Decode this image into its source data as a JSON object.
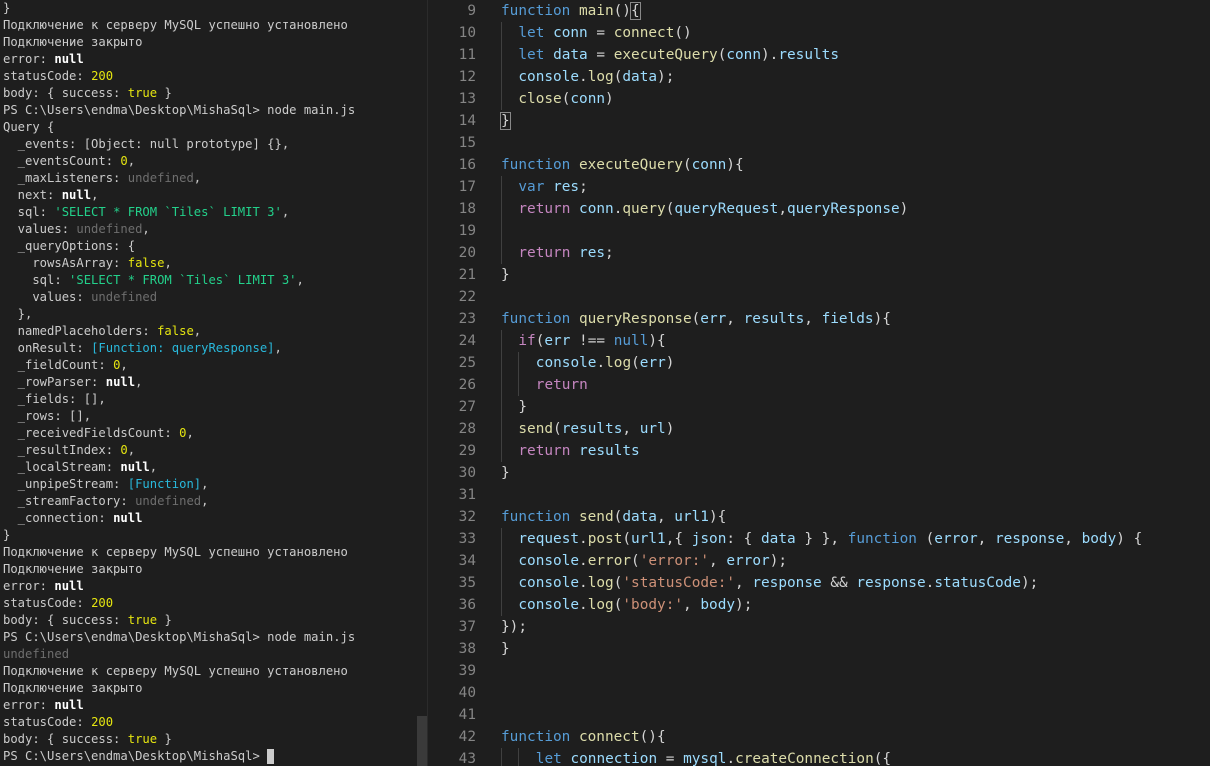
{
  "terminal": {
    "prompt": "PS C:\\Users\\endma\\Desktop\\MishaSql> ",
    "lines": [
      [
        {
          "t": "}",
          "c": ""
        }
      ],
      [
        {
          "t": "Подключение к серверу MySQL успешно установлено",
          "c": ""
        }
      ],
      [
        {
          "t": "Подключение закрыто",
          "c": ""
        }
      ],
      [
        {
          "t": "error: ",
          "c": ""
        },
        {
          "t": "null",
          "c": "t-null"
        }
      ],
      [
        {
          "t": "statusCode: ",
          "c": ""
        },
        {
          "t": "200",
          "c": "t-num"
        }
      ],
      [
        {
          "t": "body: { success: ",
          "c": ""
        },
        {
          "t": "true",
          "c": "t-bool"
        },
        {
          "t": " }",
          "c": ""
        }
      ],
      [
        {
          "t": "PS C:\\Users\\endma\\Desktop\\MishaSql> ",
          "c": ""
        },
        {
          "t": "node main.js",
          "c": ""
        }
      ],
      [
        {
          "t": "Query {",
          "c": ""
        }
      ],
      [
        {
          "t": "  _events: [Object: null prototype] {},",
          "c": ""
        }
      ],
      [
        {
          "t": "  _eventsCount: ",
          "c": ""
        },
        {
          "t": "0",
          "c": "t-num"
        },
        {
          "t": ",",
          "c": ""
        }
      ],
      [
        {
          "t": "  _maxListeners: ",
          "c": ""
        },
        {
          "t": "undefined",
          "c": "t-und"
        },
        {
          "t": ",",
          "c": ""
        }
      ],
      [
        {
          "t": "  next: ",
          "c": ""
        },
        {
          "t": "null",
          "c": "t-null"
        },
        {
          "t": ",",
          "c": ""
        }
      ],
      [
        {
          "t": "  sql: ",
          "c": ""
        },
        {
          "t": "'SELECT * FROM `Tiles` LIMIT 3'",
          "c": "t-str"
        },
        {
          "t": ",",
          "c": ""
        }
      ],
      [
        {
          "t": "  values: ",
          "c": ""
        },
        {
          "t": "undefined",
          "c": "t-und"
        },
        {
          "t": ",",
          "c": ""
        }
      ],
      [
        {
          "t": "  _queryOptions: {",
          "c": ""
        }
      ],
      [
        {
          "t": "    rowsAsArray: ",
          "c": ""
        },
        {
          "t": "false",
          "c": "t-bool"
        },
        {
          "t": ",",
          "c": ""
        }
      ],
      [
        {
          "t": "    sql: ",
          "c": ""
        },
        {
          "t": "'SELECT * FROM `Tiles` LIMIT 3'",
          "c": "t-str"
        },
        {
          "t": ",",
          "c": ""
        }
      ],
      [
        {
          "t": "    values: ",
          "c": ""
        },
        {
          "t": "undefined",
          "c": "t-und"
        }
      ],
      [
        {
          "t": "  },",
          "c": ""
        }
      ],
      [
        {
          "t": "  namedPlaceholders: ",
          "c": ""
        },
        {
          "t": "false",
          "c": "t-bool"
        },
        {
          "t": ",",
          "c": ""
        }
      ],
      [
        {
          "t": "  onResult: ",
          "c": ""
        },
        {
          "t": "[Function: queryResponse]",
          "c": "t-fn"
        },
        {
          "t": ",",
          "c": ""
        }
      ],
      [
        {
          "t": "  _fieldCount: ",
          "c": ""
        },
        {
          "t": "0",
          "c": "t-num"
        },
        {
          "t": ",",
          "c": ""
        }
      ],
      [
        {
          "t": "  _rowParser: ",
          "c": ""
        },
        {
          "t": "null",
          "c": "t-null"
        },
        {
          "t": ",",
          "c": ""
        }
      ],
      [
        {
          "t": "  _fields: [],",
          "c": ""
        }
      ],
      [
        {
          "t": "  _rows: [],",
          "c": ""
        }
      ],
      [
        {
          "t": "  _receivedFieldsCount: ",
          "c": ""
        },
        {
          "t": "0",
          "c": "t-num"
        },
        {
          "t": ",",
          "c": ""
        }
      ],
      [
        {
          "t": "  _resultIndex: ",
          "c": ""
        },
        {
          "t": "0",
          "c": "t-num"
        },
        {
          "t": ",",
          "c": ""
        }
      ],
      [
        {
          "t": "  _localStream: ",
          "c": ""
        },
        {
          "t": "null",
          "c": "t-null"
        },
        {
          "t": ",",
          "c": ""
        }
      ],
      [
        {
          "t": "  _unpipeStream: ",
          "c": ""
        },
        {
          "t": "[Function]",
          "c": "t-fn"
        },
        {
          "t": ",",
          "c": ""
        }
      ],
      [
        {
          "t": "  _streamFactory: ",
          "c": ""
        },
        {
          "t": "undefined",
          "c": "t-und"
        },
        {
          "t": ",",
          "c": ""
        }
      ],
      [
        {
          "t": "  _connection: ",
          "c": ""
        },
        {
          "t": "null",
          "c": "t-null"
        }
      ],
      [
        {
          "t": "}",
          "c": ""
        }
      ],
      [
        {
          "t": "Подключение к серверу MySQL успешно установлено",
          "c": ""
        }
      ],
      [
        {
          "t": "Подключение закрыто",
          "c": ""
        }
      ],
      [
        {
          "t": "error: ",
          "c": ""
        },
        {
          "t": "null",
          "c": "t-null"
        }
      ],
      [
        {
          "t": "statusCode: ",
          "c": ""
        },
        {
          "t": "200",
          "c": "t-num"
        }
      ],
      [
        {
          "t": "body: { success: ",
          "c": ""
        },
        {
          "t": "true",
          "c": "t-bool"
        },
        {
          "t": " }",
          "c": ""
        }
      ],
      [
        {
          "t": "PS C:\\Users\\endma\\Desktop\\MishaSql> ",
          "c": ""
        },
        {
          "t": "node main.js",
          "c": ""
        }
      ],
      [
        {
          "t": "undefined",
          "c": "t-und"
        }
      ],
      [
        {
          "t": "Подключение к серверу MySQL успешно установлено",
          "c": ""
        }
      ],
      [
        {
          "t": "Подключение закрыто",
          "c": ""
        }
      ],
      [
        {
          "t": "error: ",
          "c": ""
        },
        {
          "t": "null",
          "c": "t-null"
        }
      ],
      [
        {
          "t": "statusCode: ",
          "c": ""
        },
        {
          "t": "200",
          "c": "t-num"
        }
      ],
      [
        {
          "t": "body: { success: ",
          "c": ""
        },
        {
          "t": "true",
          "c": "t-bool"
        },
        {
          "t": " }",
          "c": ""
        }
      ]
    ]
  },
  "editor": {
    "lines": [
      {
        "n": "9",
        "g": 0,
        "tokens": [
          [
            "function",
            "kw"
          ],
          [
            " ",
            "pn"
          ],
          [
            "main",
            "fn"
          ],
          [
            "()",
            "pn"
          ],
          [
            "{",
            "pn box"
          ]
        ]
      },
      {
        "n": "10",
        "g": 1,
        "tokens": [
          [
            "let",
            "kw"
          ],
          [
            " ",
            "pn"
          ],
          [
            "conn",
            "var"
          ],
          [
            " = ",
            "pn"
          ],
          [
            "connect",
            "fn"
          ],
          [
            "()",
            "pn"
          ]
        ]
      },
      {
        "n": "11",
        "g": 1,
        "tokens": [
          [
            "let",
            "kw"
          ],
          [
            " ",
            "pn"
          ],
          [
            "data",
            "var"
          ],
          [
            " = ",
            "pn"
          ],
          [
            "executeQuery",
            "fn"
          ],
          [
            "(",
            "pn"
          ],
          [
            "conn",
            "var"
          ],
          [
            ").",
            "pn"
          ],
          [
            "results",
            "var"
          ]
        ]
      },
      {
        "n": "12",
        "g": 1,
        "tokens": [
          [
            "console",
            "var"
          ],
          [
            ".",
            "pn"
          ],
          [
            "log",
            "fn"
          ],
          [
            "(",
            "pn"
          ],
          [
            "data",
            "var"
          ],
          [
            ");",
            "pn"
          ]
        ]
      },
      {
        "n": "13",
        "g": 1,
        "tokens": [
          [
            "close",
            "fn"
          ],
          [
            "(",
            "pn"
          ],
          [
            "conn",
            "var"
          ],
          [
            ")",
            "pn"
          ]
        ]
      },
      {
        "n": "14",
        "g": 0,
        "tokens": [
          [
            "}",
            "pn box"
          ]
        ]
      },
      {
        "n": "15",
        "g": 0,
        "tokens": []
      },
      {
        "n": "16",
        "g": 0,
        "tokens": [
          [
            "function",
            "kw"
          ],
          [
            " ",
            "pn"
          ],
          [
            "executeQuery",
            "fn"
          ],
          [
            "(",
            "pn"
          ],
          [
            "conn",
            "var"
          ],
          [
            "){",
            "pn"
          ]
        ]
      },
      {
        "n": "17",
        "g": 1,
        "tokens": [
          [
            "var",
            "kw"
          ],
          [
            " ",
            "pn"
          ],
          [
            "res",
            "var"
          ],
          [
            ";",
            "pn"
          ]
        ]
      },
      {
        "n": "18",
        "g": 1,
        "tokens": [
          [
            "return",
            "ctl"
          ],
          [
            " ",
            "pn"
          ],
          [
            "conn",
            "var"
          ],
          [
            ".",
            "pn"
          ],
          [
            "query",
            "fn"
          ],
          [
            "(",
            "pn"
          ],
          [
            "queryRequest",
            "var"
          ],
          [
            ",",
            "pn"
          ],
          [
            "queryResponse",
            "var"
          ],
          [
            ")",
            "pn"
          ]
        ]
      },
      {
        "n": "19",
        "g": 1,
        "tokens": []
      },
      {
        "n": "20",
        "g": 1,
        "tokens": [
          [
            "return",
            "ctl"
          ],
          [
            " ",
            "pn"
          ],
          [
            "res",
            "var"
          ],
          [
            ";",
            "pn"
          ]
        ]
      },
      {
        "n": "21",
        "g": 0,
        "tokens": [
          [
            "}",
            "pn"
          ]
        ]
      },
      {
        "n": "22",
        "g": 0,
        "tokens": []
      },
      {
        "n": "23",
        "g": 0,
        "tokens": [
          [
            "function",
            "kw"
          ],
          [
            " ",
            "pn"
          ],
          [
            "queryResponse",
            "fn"
          ],
          [
            "(",
            "pn"
          ],
          [
            "err",
            "var"
          ],
          [
            ", ",
            "pn"
          ],
          [
            "results",
            "var"
          ],
          [
            ", ",
            "pn"
          ],
          [
            "fields",
            "var"
          ],
          [
            "){",
            "pn"
          ]
        ]
      },
      {
        "n": "24",
        "g": 1,
        "tokens": [
          [
            "if",
            "ctl"
          ],
          [
            "(",
            "pn"
          ],
          [
            "err",
            "var"
          ],
          [
            " !== ",
            "pn"
          ],
          [
            "null",
            "kw"
          ],
          [
            "){",
            "pn"
          ]
        ]
      },
      {
        "n": "25",
        "g": 2,
        "tokens": [
          [
            "console",
            "var"
          ],
          [
            ".",
            "pn"
          ],
          [
            "log",
            "fn"
          ],
          [
            "(",
            "pn"
          ],
          [
            "err",
            "var"
          ],
          [
            ")",
            "pn"
          ]
        ]
      },
      {
        "n": "26",
        "g": 2,
        "tokens": [
          [
            "return",
            "ctl"
          ]
        ]
      },
      {
        "n": "27",
        "g": 1,
        "tokens": [
          [
            "}",
            "pn"
          ]
        ]
      },
      {
        "n": "28",
        "g": 1,
        "tokens": [
          [
            "send",
            "fn"
          ],
          [
            "(",
            "pn"
          ],
          [
            "results",
            "var"
          ],
          [
            ", ",
            "pn"
          ],
          [
            "url",
            "var"
          ],
          [
            ")",
            "pn"
          ]
        ]
      },
      {
        "n": "29",
        "g": 1,
        "tokens": [
          [
            "return",
            "ctl"
          ],
          [
            " ",
            "pn"
          ],
          [
            "results",
            "var"
          ]
        ]
      },
      {
        "n": "30",
        "g": 0,
        "tokens": [
          [
            "}",
            "pn"
          ]
        ]
      },
      {
        "n": "31",
        "g": 0,
        "tokens": []
      },
      {
        "n": "32",
        "g": 0,
        "tokens": [
          [
            "function",
            "kw"
          ],
          [
            " ",
            "pn"
          ],
          [
            "send",
            "fn"
          ],
          [
            "(",
            "pn"
          ],
          [
            "data",
            "var"
          ],
          [
            ", ",
            "pn"
          ],
          [
            "url1",
            "var"
          ],
          [
            "){",
            "pn"
          ]
        ]
      },
      {
        "n": "33",
        "g": 1,
        "tokens": [
          [
            "request",
            "var"
          ],
          [
            ".",
            "pn"
          ],
          [
            "post",
            "fn"
          ],
          [
            "(",
            "pn"
          ],
          [
            "url1",
            "var"
          ],
          [
            ",{ ",
            "pn"
          ],
          [
            "json",
            "var"
          ],
          [
            ": { ",
            "pn"
          ],
          [
            "data",
            "var"
          ],
          [
            " } }, ",
            "pn"
          ],
          [
            "function",
            "kw"
          ],
          [
            " (",
            "pn"
          ],
          [
            "error",
            "var"
          ],
          [
            ", ",
            "pn"
          ],
          [
            "response",
            "var"
          ],
          [
            ", ",
            "pn"
          ],
          [
            "body",
            "var"
          ],
          [
            ") {",
            "pn"
          ]
        ]
      },
      {
        "n": "34",
        "g": 1,
        "tokens": [
          [
            "console",
            "var"
          ],
          [
            ".",
            "pn"
          ],
          [
            "error",
            "fn"
          ],
          [
            "(",
            "pn"
          ],
          [
            "'error:'",
            "str"
          ],
          [
            ", ",
            "pn"
          ],
          [
            "error",
            "var"
          ],
          [
            ");",
            "pn"
          ]
        ]
      },
      {
        "n": "35",
        "g": 1,
        "tokens": [
          [
            "console",
            "var"
          ],
          [
            ".",
            "pn"
          ],
          [
            "log",
            "fn"
          ],
          [
            "(",
            "pn"
          ],
          [
            "'statusCode:'",
            "str"
          ],
          [
            ", ",
            "pn"
          ],
          [
            "response",
            "var"
          ],
          [
            " && ",
            "pn"
          ],
          [
            "response",
            "var"
          ],
          [
            ".",
            "pn"
          ],
          [
            "statusCode",
            "var"
          ],
          [
            ");",
            "pn"
          ]
        ]
      },
      {
        "n": "36",
        "g": 1,
        "tokens": [
          [
            "console",
            "var"
          ],
          [
            ".",
            "pn"
          ],
          [
            "log",
            "fn"
          ],
          [
            "(",
            "pn"
          ],
          [
            "'body:'",
            "str"
          ],
          [
            ", ",
            "pn"
          ],
          [
            "body",
            "var"
          ],
          [
            ");",
            "pn"
          ]
        ]
      },
      {
        "n": "37",
        "g": 0,
        "tokens": [
          [
            "});",
            "pn"
          ]
        ]
      },
      {
        "n": "38",
        "g": 0,
        "tokens": [
          [
            "}",
            "pn"
          ]
        ]
      },
      {
        "n": "39",
        "g": 0,
        "tokens": []
      },
      {
        "n": "40",
        "g": 0,
        "tokens": []
      },
      {
        "n": "41",
        "g": 0,
        "tokens": []
      },
      {
        "n": "42",
        "g": 0,
        "tokens": [
          [
            "function",
            "kw"
          ],
          [
            " ",
            "pn"
          ],
          [
            "connect",
            "fn"
          ],
          [
            "(){",
            "pn"
          ]
        ]
      },
      {
        "n": "43",
        "g": 2,
        "tokens": [
          [
            "let",
            "kw"
          ],
          [
            " ",
            "pn"
          ],
          [
            "connection",
            "var"
          ],
          [
            " = ",
            "pn"
          ],
          [
            "mysql",
            "var"
          ],
          [
            ".",
            "pn"
          ],
          [
            "createConnection",
            "fn"
          ],
          [
            "({",
            "pn"
          ]
        ]
      }
    ]
  }
}
